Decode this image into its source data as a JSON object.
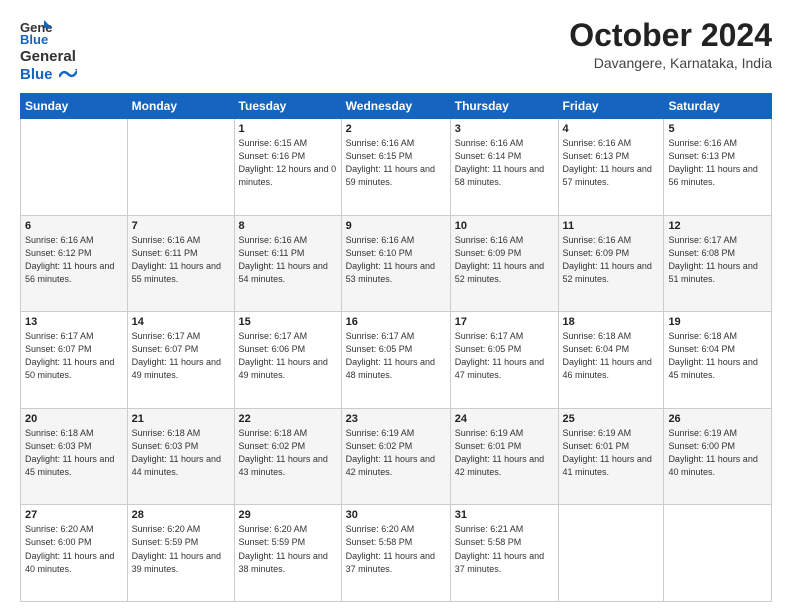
{
  "header": {
    "logo": {
      "line1": "General",
      "line2": "Blue"
    },
    "title": "October 2024",
    "location": "Davangere, Karnataka, India"
  },
  "days_of_week": [
    "Sunday",
    "Monday",
    "Tuesday",
    "Wednesday",
    "Thursday",
    "Friday",
    "Saturday"
  ],
  "weeks": [
    [
      {
        "day": "",
        "sunrise": "",
        "sunset": "",
        "daylight": ""
      },
      {
        "day": "",
        "sunrise": "",
        "sunset": "",
        "daylight": ""
      },
      {
        "day": "1",
        "sunrise": "Sunrise: 6:15 AM",
        "sunset": "Sunset: 6:16 PM",
        "daylight": "Daylight: 12 hours and 0 minutes."
      },
      {
        "day": "2",
        "sunrise": "Sunrise: 6:16 AM",
        "sunset": "Sunset: 6:15 PM",
        "daylight": "Daylight: 11 hours and 59 minutes."
      },
      {
        "day": "3",
        "sunrise": "Sunrise: 6:16 AM",
        "sunset": "Sunset: 6:14 PM",
        "daylight": "Daylight: 11 hours and 58 minutes."
      },
      {
        "day": "4",
        "sunrise": "Sunrise: 6:16 AM",
        "sunset": "Sunset: 6:13 PM",
        "daylight": "Daylight: 11 hours and 57 minutes."
      },
      {
        "day": "5",
        "sunrise": "Sunrise: 6:16 AM",
        "sunset": "Sunset: 6:13 PM",
        "daylight": "Daylight: 11 hours and 56 minutes."
      }
    ],
    [
      {
        "day": "6",
        "sunrise": "Sunrise: 6:16 AM",
        "sunset": "Sunset: 6:12 PM",
        "daylight": "Daylight: 11 hours and 56 minutes."
      },
      {
        "day": "7",
        "sunrise": "Sunrise: 6:16 AM",
        "sunset": "Sunset: 6:11 PM",
        "daylight": "Daylight: 11 hours and 55 minutes."
      },
      {
        "day": "8",
        "sunrise": "Sunrise: 6:16 AM",
        "sunset": "Sunset: 6:11 PM",
        "daylight": "Daylight: 11 hours and 54 minutes."
      },
      {
        "day": "9",
        "sunrise": "Sunrise: 6:16 AM",
        "sunset": "Sunset: 6:10 PM",
        "daylight": "Daylight: 11 hours and 53 minutes."
      },
      {
        "day": "10",
        "sunrise": "Sunrise: 6:16 AM",
        "sunset": "Sunset: 6:09 PM",
        "daylight": "Daylight: 11 hours and 52 minutes."
      },
      {
        "day": "11",
        "sunrise": "Sunrise: 6:16 AM",
        "sunset": "Sunset: 6:09 PM",
        "daylight": "Daylight: 11 hours and 52 minutes."
      },
      {
        "day": "12",
        "sunrise": "Sunrise: 6:17 AM",
        "sunset": "Sunset: 6:08 PM",
        "daylight": "Daylight: 11 hours and 51 minutes."
      }
    ],
    [
      {
        "day": "13",
        "sunrise": "Sunrise: 6:17 AM",
        "sunset": "Sunset: 6:07 PM",
        "daylight": "Daylight: 11 hours and 50 minutes."
      },
      {
        "day": "14",
        "sunrise": "Sunrise: 6:17 AM",
        "sunset": "Sunset: 6:07 PM",
        "daylight": "Daylight: 11 hours and 49 minutes."
      },
      {
        "day": "15",
        "sunrise": "Sunrise: 6:17 AM",
        "sunset": "Sunset: 6:06 PM",
        "daylight": "Daylight: 11 hours and 49 minutes."
      },
      {
        "day": "16",
        "sunrise": "Sunrise: 6:17 AM",
        "sunset": "Sunset: 6:05 PM",
        "daylight": "Daylight: 11 hours and 48 minutes."
      },
      {
        "day": "17",
        "sunrise": "Sunrise: 6:17 AM",
        "sunset": "Sunset: 6:05 PM",
        "daylight": "Daylight: 11 hours and 47 minutes."
      },
      {
        "day": "18",
        "sunrise": "Sunrise: 6:18 AM",
        "sunset": "Sunset: 6:04 PM",
        "daylight": "Daylight: 11 hours and 46 minutes."
      },
      {
        "day": "19",
        "sunrise": "Sunrise: 6:18 AM",
        "sunset": "Sunset: 6:04 PM",
        "daylight": "Daylight: 11 hours and 45 minutes."
      }
    ],
    [
      {
        "day": "20",
        "sunrise": "Sunrise: 6:18 AM",
        "sunset": "Sunset: 6:03 PM",
        "daylight": "Daylight: 11 hours and 45 minutes."
      },
      {
        "day": "21",
        "sunrise": "Sunrise: 6:18 AM",
        "sunset": "Sunset: 6:03 PM",
        "daylight": "Daylight: 11 hours and 44 minutes."
      },
      {
        "day": "22",
        "sunrise": "Sunrise: 6:18 AM",
        "sunset": "Sunset: 6:02 PM",
        "daylight": "Daylight: 11 hours and 43 minutes."
      },
      {
        "day": "23",
        "sunrise": "Sunrise: 6:19 AM",
        "sunset": "Sunset: 6:02 PM",
        "daylight": "Daylight: 11 hours and 42 minutes."
      },
      {
        "day": "24",
        "sunrise": "Sunrise: 6:19 AM",
        "sunset": "Sunset: 6:01 PM",
        "daylight": "Daylight: 11 hours and 42 minutes."
      },
      {
        "day": "25",
        "sunrise": "Sunrise: 6:19 AM",
        "sunset": "Sunset: 6:01 PM",
        "daylight": "Daylight: 11 hours and 41 minutes."
      },
      {
        "day": "26",
        "sunrise": "Sunrise: 6:19 AM",
        "sunset": "Sunset: 6:00 PM",
        "daylight": "Daylight: 11 hours and 40 minutes."
      }
    ],
    [
      {
        "day": "27",
        "sunrise": "Sunrise: 6:20 AM",
        "sunset": "Sunset: 6:00 PM",
        "daylight": "Daylight: 11 hours and 40 minutes."
      },
      {
        "day": "28",
        "sunrise": "Sunrise: 6:20 AM",
        "sunset": "Sunset: 5:59 PM",
        "daylight": "Daylight: 11 hours and 39 minutes."
      },
      {
        "day": "29",
        "sunrise": "Sunrise: 6:20 AM",
        "sunset": "Sunset: 5:59 PM",
        "daylight": "Daylight: 11 hours and 38 minutes."
      },
      {
        "day": "30",
        "sunrise": "Sunrise: 6:20 AM",
        "sunset": "Sunset: 5:58 PM",
        "daylight": "Daylight: 11 hours and 37 minutes."
      },
      {
        "day": "31",
        "sunrise": "Sunrise: 6:21 AM",
        "sunset": "Sunset: 5:58 PM",
        "daylight": "Daylight: 11 hours and 37 minutes."
      },
      {
        "day": "",
        "sunrise": "",
        "sunset": "",
        "daylight": ""
      },
      {
        "day": "",
        "sunrise": "",
        "sunset": "",
        "daylight": ""
      }
    ]
  ]
}
